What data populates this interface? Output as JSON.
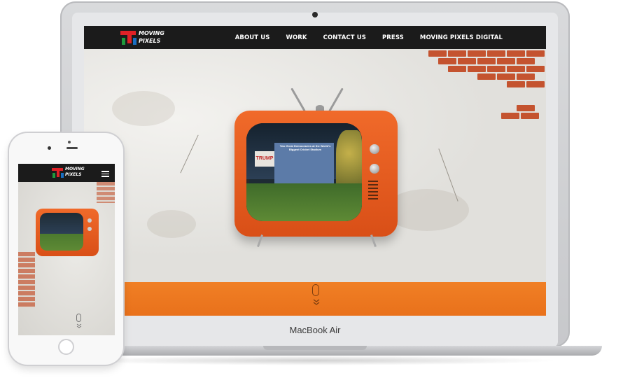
{
  "laptop": {
    "brand_label": "MacBook Air"
  },
  "site": {
    "logo_text": "MOVING\nPIXELS",
    "nav": [
      {
        "label": "ABOUT US"
      },
      {
        "label": "WORK"
      },
      {
        "label": "CONTACT US"
      },
      {
        "label": "PRESS"
      },
      {
        "label": "MOVING PIXELS DIGITAL"
      }
    ],
    "tv_billboard_text": "Two Great Democracies at the World's Biggest Cricket Stadium",
    "tv_sign_text": "TRUMP"
  },
  "colors": {
    "nav_bg": "#1b1b1b",
    "accent_orange": "#ef7a23",
    "tv_orange": "#e85d1f",
    "logo_red": "#e02127",
    "logo_green": "#1f9a3c",
    "logo_blue": "#1a6fc2"
  },
  "icons": {
    "scroll": "mouse-icon",
    "scroll_hint": "chevron-down-icon",
    "mobile_menu": "menu-icon",
    "phone_home": "home-button"
  }
}
